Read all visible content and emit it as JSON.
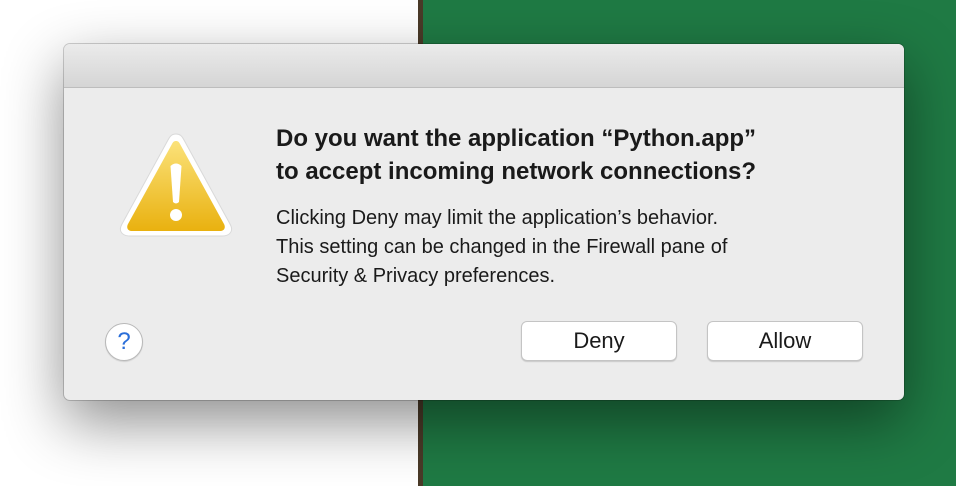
{
  "dialog": {
    "icon": "warning-triangle-icon",
    "headline_line1": "Do you want the application “Python.app”",
    "headline_line2": "to accept incoming network connections?",
    "body_line1": "Clicking Deny may limit the application’s behavior.",
    "body_line2": "This setting can be changed in the Firewall pane of",
    "body_line3": "Security & Privacy preferences.",
    "help_label": "?",
    "deny_label": "Deny",
    "allow_label": "Allow"
  },
  "colors": {
    "dialog_bg": "#ececec",
    "warning_yellow": "#f1c232",
    "help_blue": "#2a6ed9",
    "desktop_green": "#1f7a44"
  }
}
